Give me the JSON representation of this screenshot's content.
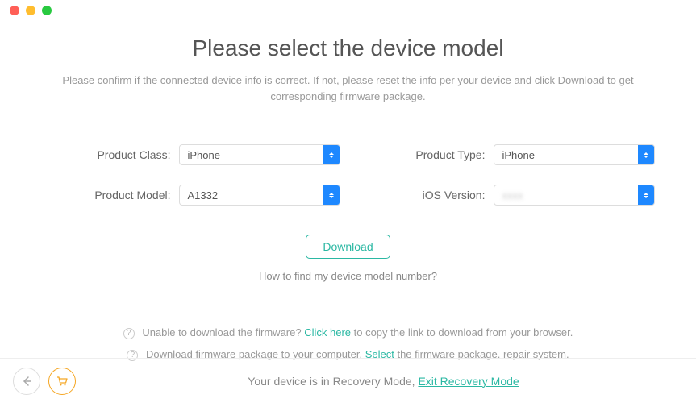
{
  "header": {
    "title": "Please select the device model",
    "subtitle": "Please confirm if the connected device info is correct. If not, please reset the info per your device and click Download to get corresponding firmware package."
  },
  "form": {
    "product_class": {
      "label": "Product Class:",
      "value": "iPhone"
    },
    "product_type": {
      "label": "Product Type:",
      "value": "iPhone"
    },
    "product_model": {
      "label": "Product Model:",
      "value": "A1332"
    },
    "ios_version": {
      "label": "iOS Version:",
      "value": ""
    }
  },
  "actions": {
    "download": "Download",
    "help": "How to find my device model number?"
  },
  "tips": {
    "line1_a": "Unable to download the firmware? ",
    "line1_link": "Click here",
    "line1_b": " to copy the link to download from your browser.",
    "line2_a": "Download firmware package to your computer, ",
    "line2_link": "Select",
    "line2_b": " the firmware package, repair system."
  },
  "footer": {
    "status_a": "Your device is in Recovery Mode, ",
    "exit": "Exit Recovery Mode"
  }
}
